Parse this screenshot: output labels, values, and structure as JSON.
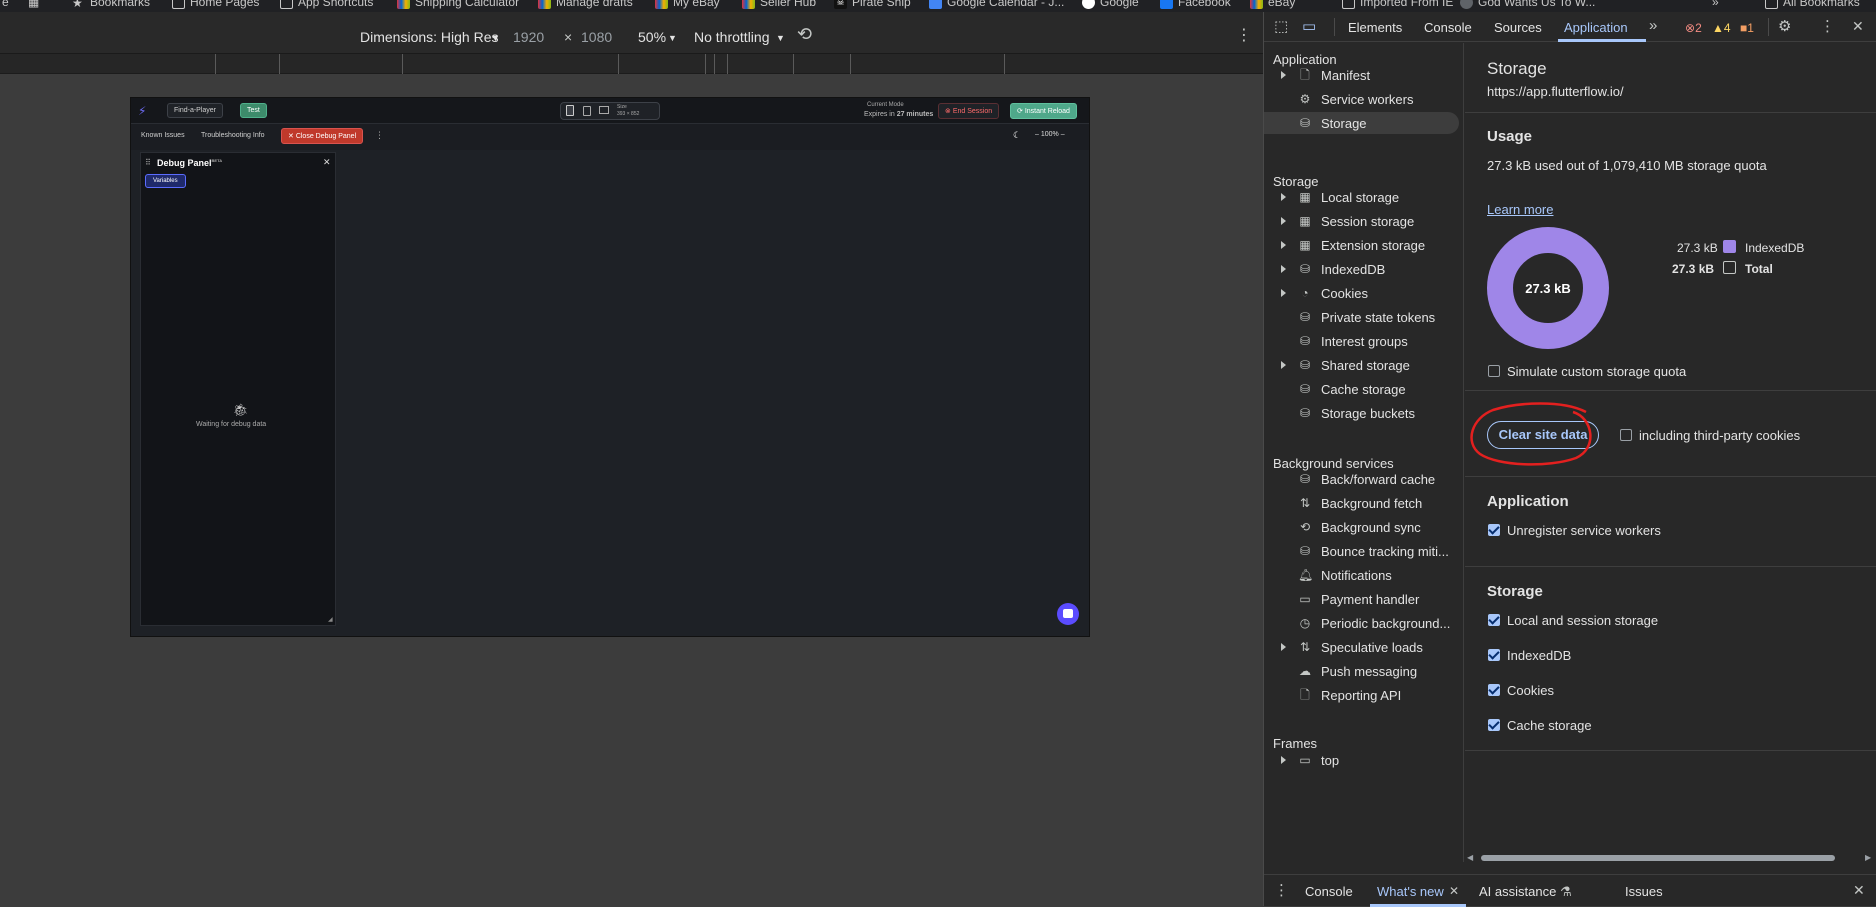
{
  "bookmarks": [
    "Bookmarks",
    "Home Pages",
    "App Shortcuts",
    "Shipping Calculator",
    "Manage drafts",
    "My eBay",
    "Seller Hub",
    "Pirate Ship",
    "Google Calendar - J...",
    "Google",
    "Facebook",
    "eBay",
    "Imported From IE",
    "God Wants Us To W...",
    "All Bookmarks"
  ],
  "device_toolbar": {
    "dimensions": "Dimensions: High Res",
    "width": "1920",
    "times": "×",
    "height": "1080",
    "zoom": "50%",
    "throttling": "No throttling"
  },
  "emulated": {
    "project": "Find-a-Player",
    "test_btn": "Test",
    "session_line1": "Current Mode",
    "session_line2": "Expires in",
    "session_minutes": "27 minutes",
    "end_session": "End Session",
    "instant_reload": "Instant Reload",
    "size_label": "Size",
    "tab_known": "Known Issues",
    "tab_troubleshoot": "Troubleshooting Info",
    "tab_close_debug": "Close Debug Panel",
    "zoom": "100%",
    "debug_title": "Debug Panel",
    "debug_beta": "BETA",
    "variables_btn": "Variables",
    "waiting": "Waiting for debug data"
  },
  "devtools": {
    "tabs": [
      "Elements",
      "Console",
      "Sources",
      "Application"
    ],
    "active_tab": "Application",
    "errors": "2",
    "warnings": "4",
    "info": "1",
    "sidebar": {
      "application_head": "Application",
      "application_items": [
        "Manifest",
        "Service workers",
        "Storage"
      ],
      "storage_head": "Storage",
      "storage_items": [
        "Local storage",
        "Session storage",
        "Extension storage",
        "IndexedDB",
        "Cookies",
        "Private state tokens",
        "Interest groups",
        "Shared storage",
        "Cache storage",
        "Storage buckets"
      ],
      "background_head": "Background services",
      "background_items": [
        "Back/forward cache",
        "Background fetch",
        "Background sync",
        "Bounce tracking miti...",
        "Notifications",
        "Payment handler",
        "Periodic background...",
        "Speculative loads",
        "Push messaging",
        "Reporting API"
      ],
      "frames_head": "Frames",
      "frames_items": [
        "top"
      ]
    },
    "main": {
      "title": "Storage",
      "origin": "https://app.flutterflow.io/",
      "usage_head": "Usage",
      "usage_text": "27.3 kB used out of 1,079,410 MB storage quota",
      "learn_more": "Learn more",
      "donut_label": "27.3 kB",
      "legend": [
        {
          "value": "27.3 kB",
          "name": "IndexedDB",
          "color": "#9f86e8"
        },
        {
          "value": "27.3 kB",
          "name": "Total",
          "color": "none"
        }
      ],
      "simulate_quota": "Simulate custom storage quota",
      "clear_button": "Clear site data",
      "third_party": "including third-party cookies",
      "application_head": "Application",
      "unregister_sw": "Unregister service workers",
      "storage_head": "Storage",
      "storage_checks": [
        "Local and session storage",
        "IndexedDB",
        "Cookies",
        "Cache storage"
      ]
    },
    "drawer": {
      "tabs": [
        "Console",
        "What's new",
        "AI assistance",
        "Issues"
      ],
      "active": "What's new"
    }
  },
  "colors": {
    "accent": "#a8c7fa",
    "donut": "#9f86e8",
    "annotation": "#e3201f"
  }
}
